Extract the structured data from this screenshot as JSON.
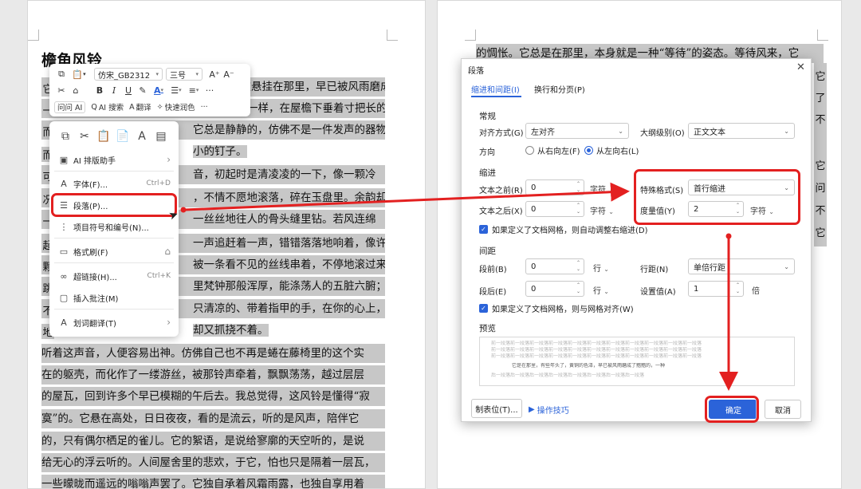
{
  "left_doc": {
    "title": "檐角风铃",
    "lines": [
      "它被悬挂在那里，早已被风雨磨成了黯黯的，",
      "一样，在屋檐下垂着寸把长的穗子，也",
      "它总是静静的，仿佛不是一件发声的器物，",
      "小的钉子。",
      "音，初起时是清凌凌的一下，像一颗冷",
      "，不情不愿地滚落，碎在玉盘里。余韵却",
      "一丝丝地往人的骨头缝里钻。若风连绵",
      "一声追赶着一声，错错落落地响着，像许",
      "被一条看不见的丝线串着，不停地滚过来，",
      "里梵钟那般浑厚，能涤荡人的五脏六腑；",
      "只清凉的、带着指甲的手，在你的心上，",
      "却又抓挠不着。",
      "听着这声音，人便容易出神。仿佛自己也不再是蜷在藤椅里的这个实",
      "在的躯壳，而化作了一缕游丝，被那铃声牵着，飘飘荡荡，越过层层",
      "的屋瓦，回到许多个早已模糊的午后去。我总觉得，这风铃是懂得“寂",
      "寞”的。它悬在高处，日日夜夜，看的是流云，听的是风声，陪伴它",
      "的，只有偶尔栖足的雀儿。它的絮语，是说给寥廓的天空听的，是说",
      "给无心的浮云听的。人间屋舍里的悲欢，于它，怕也只是隔着一层瓦，",
      "一些曚昽而遥远的嗡嗡声罢了。它独自承着风霜雨露，也独自享用着"
    ],
    "left_margin_chars": [
      "它",
      "一",
      "而",
      "可",
      "况",
      "一",
      "起",
      "颗",
      "跳",
      "不",
      "地",
      "一"
    ]
  },
  "right_doc": {
    "lines": [
      "的惆怅。它总是在那里，本身就是一种“等待”的姿态。等待风来，它"
    ],
    "side_chars": [
      "它",
      "了",
      "不",
      "它",
      "问",
      "不",
      "它"
    ]
  },
  "mini_toolbar": {
    "font_name": "仿宋_GB2312",
    "font_size": "三号",
    "grow_font": "A⁺",
    "shrink_font": "A⁻",
    "bold": "B",
    "italic": "I",
    "underline": "U",
    "ask_ai": "问问 AI",
    "ai_search": "AI 搜索",
    "translate": "翻译",
    "quick_color": "快速润色",
    "more": "···"
  },
  "context_menu": {
    "items": [
      {
        "label": "AI 排版助手",
        "shortcut": "",
        "submenu": true
      },
      {
        "label": "字体(F)...",
        "shortcut": "Ctrl+D",
        "submenu": false
      },
      {
        "label": "段落(P)...",
        "shortcut": "",
        "submenu": false
      },
      {
        "label": "项目符号和编号(N)...",
        "shortcut": "",
        "submenu": false
      },
      {
        "label": "格式刷(F)",
        "shortcut": "",
        "submenu": false
      },
      {
        "label": "超链接(H)...",
        "shortcut": "Ctrl+K",
        "submenu": false
      },
      {
        "label": "插入批注(M)",
        "shortcut": "",
        "submenu": false
      },
      {
        "label": "划词翻译(T)",
        "shortcut": "",
        "submenu": true
      }
    ]
  },
  "dialog": {
    "title": "段落",
    "close": "✕",
    "tabs": [
      "缩进和间距(I)",
      "换行和分页(P)"
    ],
    "general": {
      "section": "常规",
      "align_label": "对齐方式(G)",
      "align_value": "左对齐",
      "outline_label": "大纲级别(O)",
      "outline_value": "正文文本",
      "direction_label": "方向",
      "rtl_label": "从右向左(F)",
      "ltr_label": "从左向右(L)"
    },
    "indent": {
      "section": "缩进",
      "before_label": "文本之前(R)",
      "before_value": "0",
      "before_unit": "字符",
      "after_label": "文本之后(X)",
      "after_value": "0",
      "after_unit": "字符",
      "special_label": "特殊格式(S)",
      "special_value": "首行缩进",
      "measure_label": "度量值(Y)",
      "measure_value": "2",
      "measure_unit": "字符",
      "auto_adjust": "如果定义了文档网格，则自动调整右缩进(D)"
    },
    "spacing": {
      "section": "间距",
      "before_label": "段前(B)",
      "before_value": "0",
      "before_unit": "行",
      "after_label": "段后(E)",
      "after_value": "0",
      "after_unit": "行",
      "line_label": "行距(N)",
      "line_value": "单倍行距",
      "setting_label": "设置值(A)",
      "setting_value": "1",
      "setting_unit": "倍",
      "snap_grid": "如果定义了文档网格，则与网格对齐(W)"
    },
    "preview": {
      "section": "预览",
      "sample_prev": "前一段落前一段落前一段落前一段落前一段落前一段落前一段落前一段落前一段落前一段落前一段落",
      "sample_main": "它是在那里，有些年头了，黄铜的色泽，早已被风雨磨成了黯黯的，一种",
      "sample_next": "后一段落后一段落后一段落后一段落后一段落后一段落后一段落后一段落"
    },
    "tabs_button": "制表位(T)...",
    "tips_link": "操作技巧",
    "ok": "确定",
    "cancel": "取消"
  },
  "colors": {
    "accent": "#2b63d9",
    "highlight": "#e32020",
    "selection": "#c7c7c7"
  }
}
